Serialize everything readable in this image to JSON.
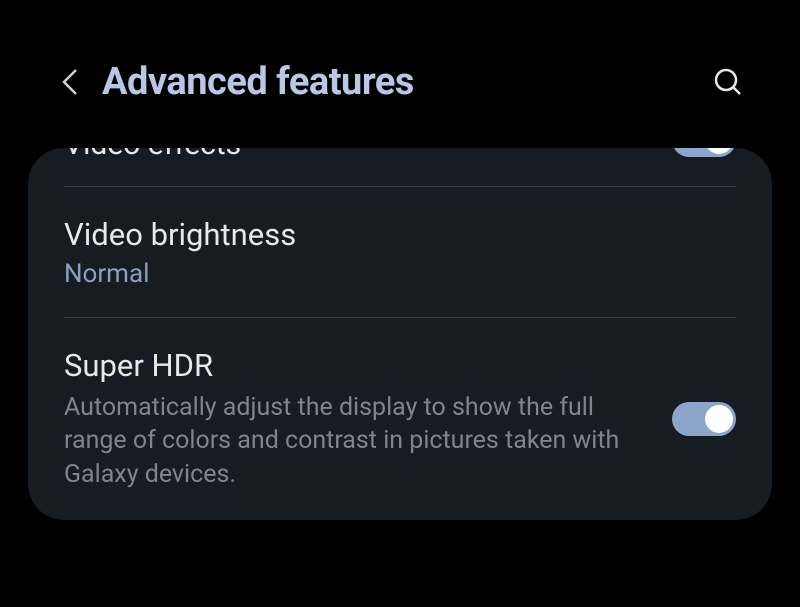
{
  "header": {
    "title": "Advanced features"
  },
  "settings": {
    "video_effects": {
      "label": "Video effects",
      "enabled": true
    },
    "video_brightness": {
      "label": "Video brightness",
      "value": "Normal"
    },
    "super_hdr": {
      "label": "Super HDR",
      "description": "Automatically adjust the display to show the full range of colors and contrast in pictures taken with Galaxy devices.",
      "enabled": true
    }
  }
}
